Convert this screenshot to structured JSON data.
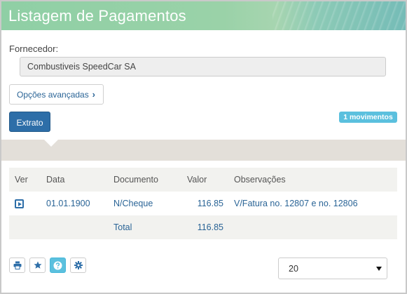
{
  "header": {
    "title": "Listagem de Pagamentos"
  },
  "filters": {
    "fornecedor_label": "Fornecedor:",
    "fornecedor_value": "Combustiveis SpeedCar SA",
    "opcoes_label": "Opções avançadas",
    "extrato_label": "Extrato",
    "badge": "1 movimentos"
  },
  "table": {
    "headers": [
      "Ver",
      "Data",
      "Documento",
      "Valor",
      "Observações"
    ],
    "rows": [
      {
        "data": "01.01.1900",
        "documento": "N/Cheque",
        "valor": "116.85",
        "observacoes": "V/Fatura no. 12807 e no. 12806"
      }
    ],
    "total_label": "Total",
    "total_value": "116.85"
  },
  "toolbar": {
    "icons": [
      "print-icon",
      "star-icon",
      "help-icon",
      "gear-icon"
    ]
  },
  "pagination": {
    "page_size": "20"
  },
  "colors": {
    "primary": "#2d6ea8",
    "info": "#5bc0de",
    "band": "#e3dfd9"
  }
}
